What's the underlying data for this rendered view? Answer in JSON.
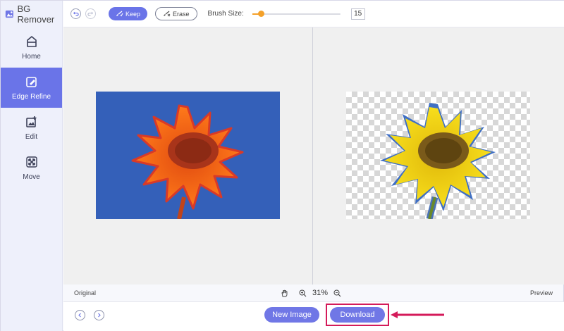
{
  "app": {
    "title": "BG Remover"
  },
  "sidebar": {
    "items": [
      {
        "label": "Home",
        "icon": "home-icon"
      },
      {
        "label": "Edge Refine",
        "icon": "edge-refine-icon",
        "active": true
      },
      {
        "label": "Edit",
        "icon": "edit-image-icon"
      },
      {
        "label": "Move",
        "icon": "move-arrows-icon"
      }
    ]
  },
  "toolbar": {
    "keep_label": "Keep",
    "erase_label": "Erase",
    "brush_label": "Brush Size:",
    "brush_value": "15",
    "brush_fraction": 0.1
  },
  "status": {
    "left_label": "Original",
    "right_label": "Preview",
    "zoom": "31%"
  },
  "bottom": {
    "new_image_label": "New Image",
    "download_label": "Download"
  },
  "colors": {
    "accent": "#6a74e8",
    "slider": "#f4a12a",
    "highlight": "#d41a5a"
  }
}
